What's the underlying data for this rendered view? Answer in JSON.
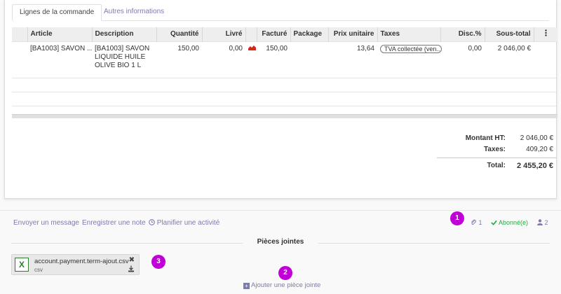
{
  "tabs": [
    {
      "label": "Lignes de la commande",
      "active": true
    },
    {
      "label": "Autres informations",
      "active": false
    }
  ],
  "table": {
    "columns": [
      "Article",
      "Description",
      "Quantité",
      "Livré",
      "Facturé",
      "Package",
      "Prix unitaire",
      "Taxes",
      "Disc.%",
      "Sous-total"
    ],
    "row": {
      "article": "[BA1003] SAVON ...",
      "description": "[BA1003] SAVON LIQUIDE HUILE OLIVE BIO 1 L",
      "quantity": "150,00",
      "delivered": "0,00",
      "invoiced": "150,00",
      "package": "",
      "unit_price": "13,64",
      "tax": "TVA collectée (ven...",
      "discount": "0,00",
      "subtotal": "2 046,00 €"
    }
  },
  "totals": {
    "untaxed_label": "Montant HT:",
    "untaxed_value": "2 046,00 €",
    "taxes_label": "Taxes:",
    "taxes_value": "409,20 €",
    "total_label": "Total:",
    "total_value": "2 455,20 €"
  },
  "chatter": {
    "send_message": "Envoyer un message",
    "log_note": "Enregistrer une note",
    "schedule_activity": "Planifier une activité",
    "attachment_count": "1",
    "follow_label": "Abonné(e)",
    "followers_count": "2"
  },
  "attachments": {
    "heading": "Pièces jointes",
    "file_name": "account.payment.term-ajout.csv",
    "file_ext": "csv",
    "add_label": "Ajouter une pièce jointe"
  },
  "badges": [
    "1",
    "2",
    "3"
  ],
  "colors": {
    "accent": "#7c7bad",
    "badge": "#c000d6",
    "follow": "#28a745",
    "excel": "#2e7d32"
  }
}
